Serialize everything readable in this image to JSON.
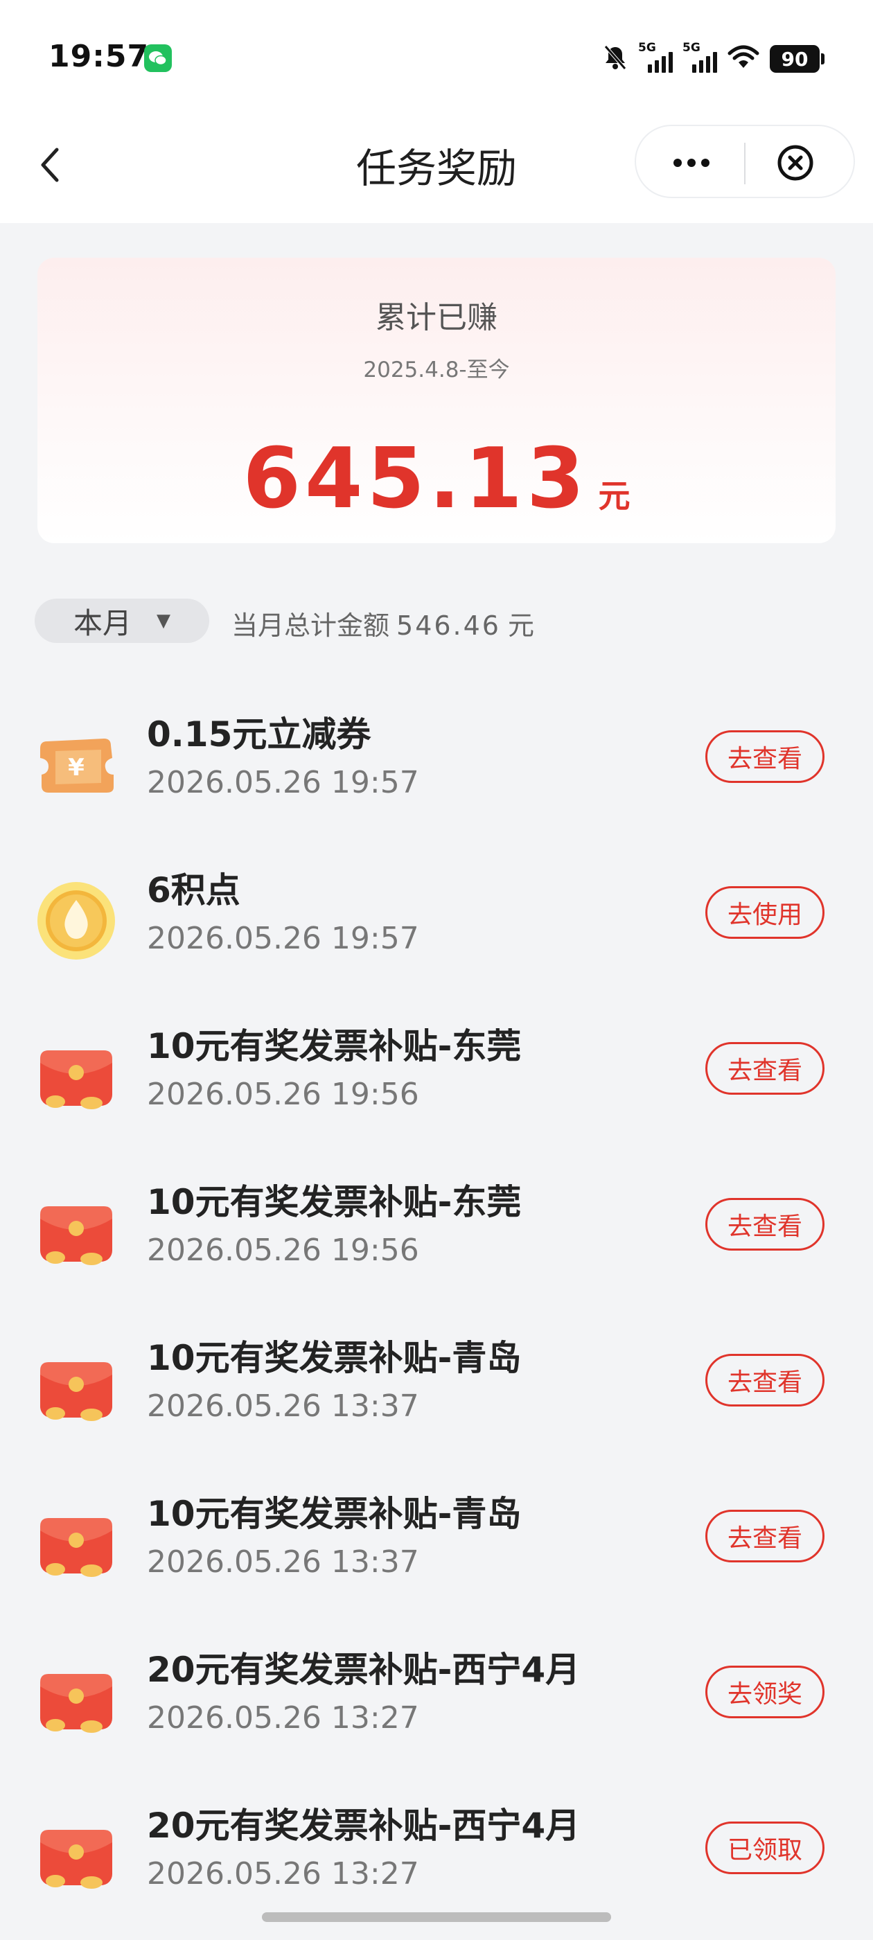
{
  "status_bar": {
    "time": "19:57",
    "signal1_label": "5G",
    "signal2_label": "5G",
    "battery": "90",
    "icons": [
      "wechat-icon",
      "mute-bell-icon",
      "signal-icon",
      "signal-icon",
      "wifi-icon",
      "battery-icon"
    ]
  },
  "header": {
    "title": "任务奖励",
    "back_icon": "chevron-left-icon",
    "more_icon": "more-dots-icon",
    "close_icon": "close-circle-icon"
  },
  "summary": {
    "title": "累计已赚",
    "date_range": "2025.4.8-至今",
    "amount": "645.13",
    "unit": "元"
  },
  "filter": {
    "period_label": "本月",
    "caret": "▼",
    "total_prefix": "当月总计金额",
    "total_amount": "546.46",
    "total_unit": "元"
  },
  "items": [
    {
      "title": "0.15元立减券",
      "time": "2026.05.26 19:57",
      "action": "去查看",
      "icon": "coupon-icon"
    },
    {
      "title": "6积点",
      "time": "2026.05.26 19:57",
      "action": "去使用",
      "icon": "points-coin-icon"
    },
    {
      "title": "10元有奖发票补贴-东莞",
      "time": "2026.05.26 19:56",
      "action": "去查看",
      "icon": "red-packet-icon"
    },
    {
      "title": "10元有奖发票补贴-东莞",
      "time": "2026.05.26 19:56",
      "action": "去查看",
      "icon": "red-packet-icon"
    },
    {
      "title": "10元有奖发票补贴-青岛",
      "time": "2026.05.26 13:37",
      "action": "去查看",
      "icon": "red-packet-icon"
    },
    {
      "title": "10元有奖发票补贴-青岛",
      "time": "2026.05.26 13:37",
      "action": "去查看",
      "icon": "red-packet-icon"
    },
    {
      "title": "20元有奖发票补贴-西宁4月",
      "time": "2026.05.26 13:27",
      "action": "去领奖",
      "icon": "red-packet-icon"
    },
    {
      "title": "20元有奖发票补贴-西宁4月",
      "time": "2026.05.26 13:27",
      "action": "已领取",
      "icon": "red-packet-icon"
    }
  ],
  "colors": {
    "accent": "#e0342b",
    "background": "#f3f4f6"
  }
}
